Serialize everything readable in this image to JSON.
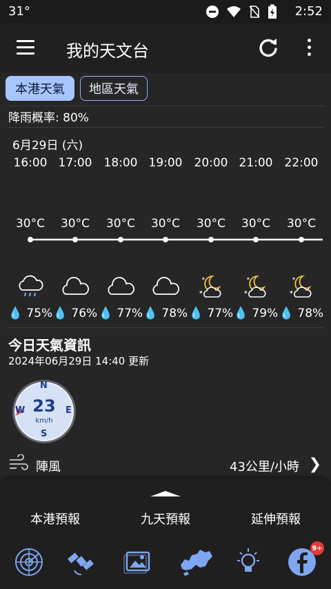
{
  "status_bar": {
    "temperature": "31°",
    "time": "2:52"
  },
  "app_bar": {
    "title": "我的天文台"
  },
  "tabs": [
    {
      "label": "本港天氣",
      "active": true
    },
    {
      "label": "地區天氣",
      "active": false
    }
  ],
  "rain_probability": "降雨概率: 80%",
  "forecast": {
    "date": "6月29日 (六)",
    "hours": [
      "16:00",
      "17:00",
      "18:00",
      "19:00",
      "20:00",
      "21:00",
      "22:00"
    ],
    "temperatures": [
      "30°C",
      "30°C",
      "30°C",
      "30°C",
      "30°C",
      "30°C",
      "30°C"
    ],
    "temperature_values": [
      30,
      30,
      30,
      30,
      30,
      30,
      30
    ],
    "icons": [
      "rain-cloud-icon",
      "cloud-icon",
      "cloud-icon",
      "cloud-icon",
      "night-cloud-icon",
      "night-cloud-icon",
      "night-cloud-icon"
    ],
    "humidity": [
      "75%",
      "76%",
      "77%",
      "78%",
      "77%",
      "79%",
      "78%"
    ]
  },
  "today_info": {
    "title": "今日天氣資訊",
    "updated": "2024年06月29日 14:40 更新"
  },
  "wind": {
    "speed": "23",
    "unit": "km/h",
    "directions": {
      "n": "N",
      "e": "E",
      "s": "S",
      "w": "W"
    }
  },
  "gust": {
    "label": "陣風",
    "value": "43公里/小時",
    "chevron": "❯"
  },
  "bottom_nav": {
    "links": [
      "本港預報",
      "九天預報",
      "延伸預報"
    ],
    "badge": "9+"
  },
  "colors": {
    "accent": "#a7c6ff",
    "icon_blue": "#7fa6f0",
    "background": "#262626"
  }
}
